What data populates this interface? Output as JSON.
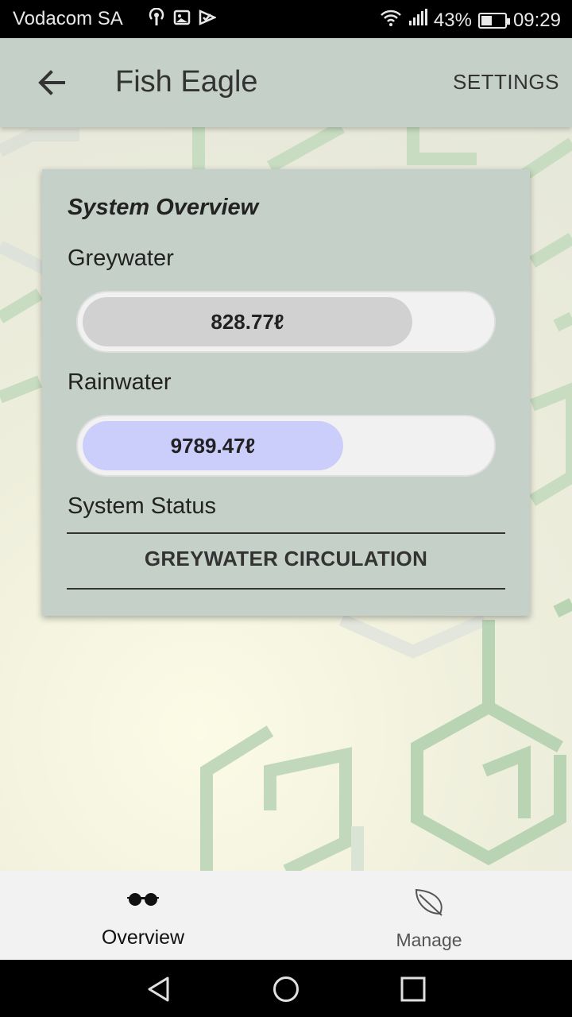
{
  "status_bar": {
    "carrier": "Vodacom SA",
    "battery_percent": "43%",
    "time": "09:29",
    "icons": [
      "podcast-icon",
      "image-notification-icon",
      "check-notification-icon",
      "wifi-icon",
      "signal-icon",
      "battery-icon"
    ]
  },
  "app_bar": {
    "back_icon": "arrow-left-icon",
    "title": "Fish Eagle",
    "settings_label": "SETTINGS"
  },
  "overview": {
    "title": "System Overview",
    "greywater": {
      "label": "Greywater",
      "value": "828.77ℓ",
      "fill_fraction": 0.81,
      "color": "#d1d1d1"
    },
    "rainwater": {
      "label": "Rainwater",
      "value": "9789.47ℓ",
      "fill_fraction": 0.64,
      "color": "#cbcdfb"
    },
    "status": {
      "label": "System Status",
      "value": "GREYWATER CIRCULATION"
    }
  },
  "bottom_nav": {
    "items": [
      {
        "label": "Overview",
        "icon": "glasses-icon",
        "active": true
      },
      {
        "label": "Manage",
        "icon": "leaf-icon",
        "active": false
      }
    ]
  },
  "system_nav": [
    "back-triangle-icon",
    "home-circle-icon",
    "recents-square-icon"
  ],
  "colors": {
    "app_bar": "#c5d0c8",
    "card": "#c5d0c8",
    "hex_pattern": "#b5d2b0"
  }
}
